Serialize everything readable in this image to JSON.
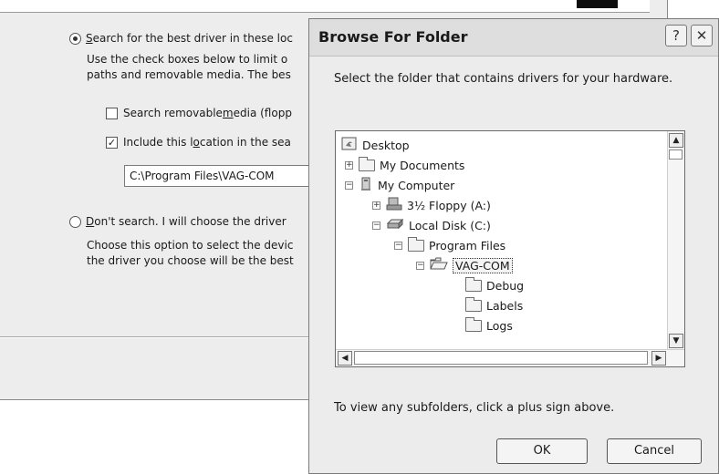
{
  "wizard": {
    "option_search": {
      "label_mnemonic": "S",
      "label_rest": "earch for the best driver in these loc",
      "selected": true,
      "desc_line1": "Use the check boxes below to limit o",
      "desc_line2": "paths and removable media. The bes"
    },
    "check_removable": {
      "label_pre": "Search removable ",
      "label_mnemonic": "m",
      "label_post": "edia (flopp",
      "checked": false
    },
    "check_include": {
      "label_pre": "Include this l",
      "label_mnemonic": "o",
      "label_post": "cation in the sea",
      "checked": true,
      "check_glyph": "✓"
    },
    "path_value": "C:\\Program Files\\VAG-COM",
    "option_dont": {
      "label_mnemonic": "D",
      "label_rest": "on't search. I will choose the driver",
      "selected": false,
      "desc_line1": "Choose this option to select the devic",
      "desc_line2": "the driver you choose will be the best"
    }
  },
  "browse_dialog": {
    "title": "Browse For Folder",
    "help_button": "?",
    "close_button": "✕",
    "instruction": "Select the folder that contains drivers for your hardware.",
    "tree": [
      {
        "label": "Desktop",
        "expander": "",
        "icon": "desktop-icon"
      },
      {
        "label": "My Documents",
        "expander": "+",
        "icon": "folder-icon"
      },
      {
        "label": "My Computer",
        "expander": "−",
        "icon": "computer-icon"
      },
      {
        "label": "3½ Floppy (A:)",
        "expander": "+",
        "icon": "floppy-icon"
      },
      {
        "label": "Local Disk (C:)",
        "expander": "−",
        "icon": "disk-icon"
      },
      {
        "label": "Program Files",
        "expander": "−",
        "icon": "folder-icon"
      },
      {
        "label": "VAG-COM",
        "expander": "−",
        "icon": "open-folder-icon",
        "selected": true
      },
      {
        "label": "Debug",
        "expander": "",
        "icon": "folder-icon"
      },
      {
        "label": "Labels",
        "expander": "",
        "icon": "folder-icon"
      },
      {
        "label": "Logs",
        "expander": "",
        "icon": "folder-icon"
      }
    ],
    "scroll_up": "▲",
    "scroll_down": "▼",
    "scroll_left": "◀",
    "scroll_right": "▶",
    "hint": "To view any subfolders, click a plus sign above.",
    "ok_label": "OK",
    "cancel_label": "Cancel"
  }
}
